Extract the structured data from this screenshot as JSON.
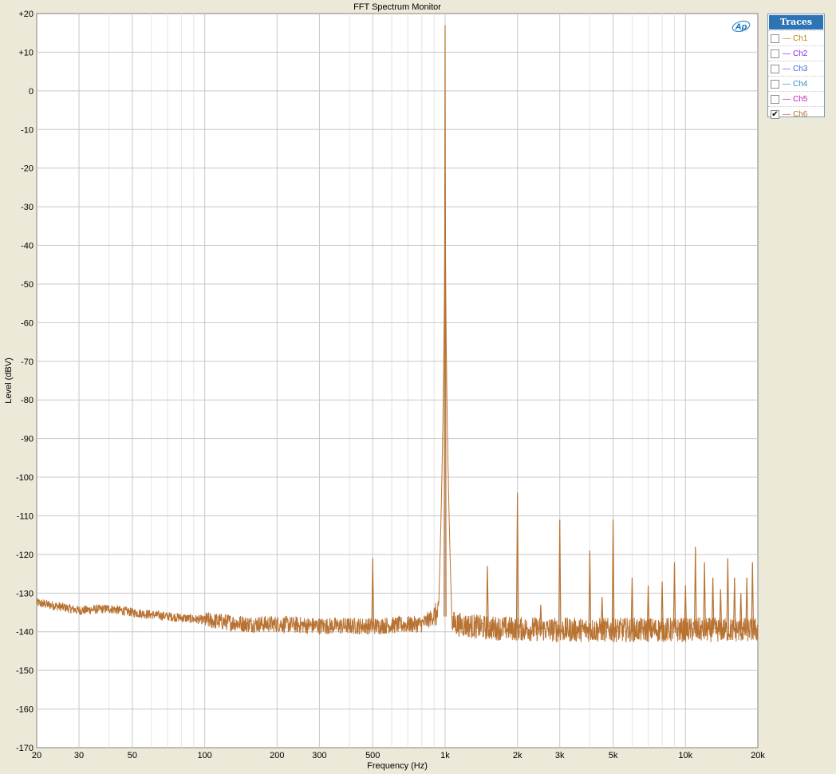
{
  "window": {
    "title": "FFT Spectrum Monitor"
  },
  "logo": {
    "text": "Ap"
  },
  "traces": {
    "header": "Traces",
    "items": [
      {
        "name": "Ch1",
        "checked": false,
        "color": "#b8860b"
      },
      {
        "name": "Ch2",
        "checked": false,
        "color": "#8a2be2"
      },
      {
        "name": "Ch3",
        "checked": false,
        "color": "#4169e1"
      },
      {
        "name": "Ch4",
        "checked": false,
        "color": "#2f8fbf"
      },
      {
        "name": "Ch5",
        "checked": false,
        "color": "#c020c0"
      },
      {
        "name": "Ch6",
        "checked": true,
        "color": "#b87333"
      }
    ]
  },
  "chart_data": {
    "type": "line",
    "title": "FFT Spectrum Monitor",
    "xlabel": "Frequency (Hz)",
    "ylabel": "Level (dBV)",
    "xscale": "log",
    "xlim": [
      20,
      20000
    ],
    "ylim": [
      -170,
      20
    ],
    "grid": true,
    "x_ticks": [
      20,
      30,
      50,
      100,
      200,
      300,
      500,
      1000,
      2000,
      3000,
      5000,
      10000,
      20000
    ],
    "x_tick_labels": [
      "20",
      "30",
      "50",
      "100",
      "200",
      "300",
      "500",
      "1k",
      "2k",
      "3k",
      "5k",
      "10k",
      "20k"
    ],
    "y_ticks": [
      20,
      10,
      0,
      -10,
      -20,
      -30,
      -40,
      -50,
      -60,
      -70,
      -80,
      -90,
      -100,
      -110,
      -120,
      -130,
      -140,
      -150,
      -160,
      -170
    ],
    "y_tick_labels": [
      "+20",
      "+10",
      "0",
      "-10",
      "-20",
      "-30",
      "-40",
      "-50",
      "-60",
      "-70",
      "-80",
      "-90",
      "-100",
      "-110",
      "-120",
      "-130",
      "-140",
      "-150",
      "-160",
      "-170"
    ],
    "series": [
      {
        "name": "Ch6",
        "color": "#b87333",
        "noise_floor": [
          {
            "x": 20,
            "y": -132.5
          },
          {
            "x": 25,
            "y": -133.5
          },
          {
            "x": 30,
            "y": -134.5
          },
          {
            "x": 40,
            "y": -134
          },
          {
            "x": 50,
            "y": -135
          },
          {
            "x": 70,
            "y": -136
          },
          {
            "x": 100,
            "y": -137
          },
          {
            "x": 150,
            "y": -138
          },
          {
            "x": 200,
            "y": -138
          },
          {
            "x": 300,
            "y": -138.5
          },
          {
            "x": 500,
            "y": -138.5
          },
          {
            "x": 800,
            "y": -138
          },
          {
            "x": 950,
            "y": -135
          },
          {
            "x": 1100,
            "y": -138
          },
          {
            "x": 1500,
            "y": -139
          },
          {
            "x": 3000,
            "y": -139.5
          },
          {
            "x": 10000,
            "y": -139.5
          },
          {
            "x": 20000,
            "y": -139.5
          }
        ],
        "peaks": [
          {
            "x": 500,
            "y": -121
          },
          {
            "x": 1000,
            "y": 17
          },
          {
            "x": 1500,
            "y": -123
          },
          {
            "x": 2000,
            "y": -104
          },
          {
            "x": 2500,
            "y": -133
          },
          {
            "x": 3000,
            "y": -111
          },
          {
            "x": 4000,
            "y": -119
          },
          {
            "x": 4500,
            "y": -131
          },
          {
            "x": 5000,
            "y": -111
          },
          {
            "x": 6000,
            "y": -126
          },
          {
            "x": 7000,
            "y": -128
          },
          {
            "x": 8000,
            "y": -127
          },
          {
            "x": 9000,
            "y": -122
          },
          {
            "x": 10000,
            "y": -128
          },
          {
            "x": 11000,
            "y": -118
          },
          {
            "x": 12000,
            "y": -122
          },
          {
            "x": 13000,
            "y": -126
          },
          {
            "x": 14000,
            "y": -129
          },
          {
            "x": 15000,
            "y": -121
          },
          {
            "x": 16000,
            "y": -126
          },
          {
            "x": 17000,
            "y": -130
          },
          {
            "x": 18000,
            "y": -126
          },
          {
            "x": 19000,
            "y": -122
          }
        ]
      }
    ]
  }
}
